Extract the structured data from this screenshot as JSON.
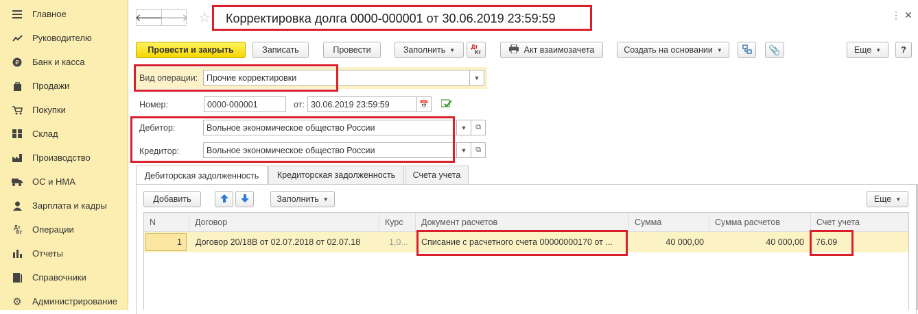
{
  "sidebar": {
    "items": [
      {
        "label": "Главное",
        "icon": "menu-icon"
      },
      {
        "label": "Руководителю",
        "icon": "trend-icon"
      },
      {
        "label": "Банк и касса",
        "icon": "coin-icon"
      },
      {
        "label": "Продажи",
        "icon": "bag-icon"
      },
      {
        "label": "Покупки",
        "icon": "cart-icon"
      },
      {
        "label": "Склад",
        "icon": "warehouse-icon"
      },
      {
        "label": "Производство",
        "icon": "factory-icon"
      },
      {
        "label": "ОС и НМА",
        "icon": "truck-icon"
      },
      {
        "label": "Зарплата и кадры",
        "icon": "person-icon"
      },
      {
        "label": "Операции",
        "icon": "dt-kt-icon"
      },
      {
        "label": "Отчеты",
        "icon": "bar-chart-icon"
      },
      {
        "label": "Справочники",
        "icon": "books-icon"
      },
      {
        "label": "Администрирование",
        "icon": "gear-icon"
      }
    ]
  },
  "header": {
    "title": "Корректировка долга 0000-000001 от 30.06.2019 23:59:59"
  },
  "toolbar": {
    "post_close": "Провести и закрыть",
    "save": "Записать",
    "post": "Провести",
    "fill": "Заполнить",
    "dtkt_top": "Дт",
    "dtkt_bottom": "Кт",
    "act": "Акт взаимозачета",
    "create_based": "Создать на основании",
    "more": "Еще",
    "help": "?"
  },
  "form": {
    "op_type_label": "Вид операции:",
    "op_type_value": "Прочие корректировки",
    "number_label": "Номер:",
    "number_value": "0000-000001",
    "date_label": "от:",
    "date_value": "30.06.2019 23:59:59",
    "debtor_label": "Дебитор:",
    "debtor_value": "Вольное экономическое общество России",
    "creditor_label": "Кредитор:",
    "creditor_value": "Вольное экономическое общество России"
  },
  "tabs": [
    "Дебиторская задолженность",
    "Кредиторская задолженность",
    "Счета учета"
  ],
  "table_toolbar": {
    "add": "Добавить",
    "fill": "Заполнить",
    "more": "Еще"
  },
  "table": {
    "headers": [
      "N",
      "Договор",
      "Курс",
      "Документ расчетов",
      "Сумма",
      "Сумма расчетов",
      "Счет учета"
    ],
    "rows": [
      {
        "n": "1",
        "contract": "Договор 20/18В от 02.07.2018 от 02.07.18",
        "rate": "1,0...",
        "doc": "Списание с расчетного счета 00000000170 от ...",
        "sum": "40 000,00",
        "sum_calc": "40 000,00",
        "account": "76.09"
      }
    ]
  },
  "colors": {
    "sidebar_bg": "#fbeeb0",
    "primary_button": "#f5d500",
    "highlight_red": "#d9202a",
    "selected_row": "#fbf3c3"
  }
}
